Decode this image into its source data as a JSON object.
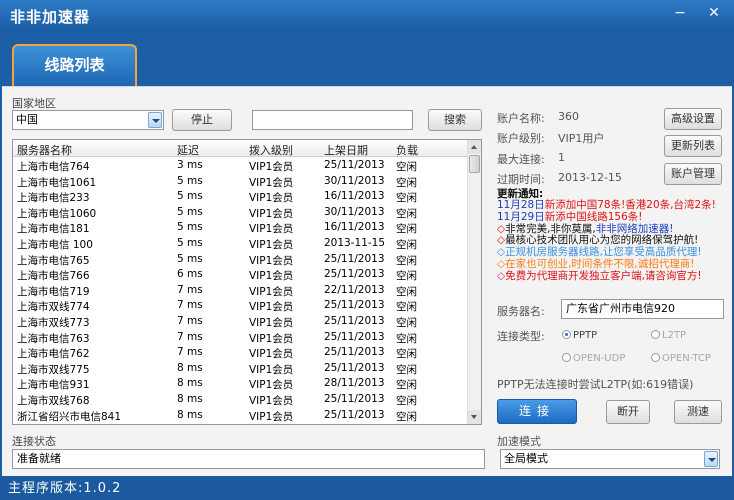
{
  "window": {
    "title": "非非加速器",
    "tab_label": "线路列表",
    "version_text": "主程序版本:1.0.2"
  },
  "region": {
    "label": "国家地区",
    "selected": "中国",
    "stop_label": "停止",
    "search_value": "",
    "search_label": "搜索"
  },
  "table": {
    "columns": [
      "服务器名称",
      "延迟",
      "拨入级别",
      "上架日期",
      "负载"
    ],
    "rows": [
      [
        "上海市电信764",
        "3 ms",
        "VIP1会员",
        "25/11/2013",
        "空闲"
      ],
      [
        "上海市电信1061",
        "5 ms",
        "VIP1会员",
        "30/11/2013",
        "空闲"
      ],
      [
        "上海市电信233",
        "5 ms",
        "VIP1会员",
        "16/11/2013",
        "空闲"
      ],
      [
        "上海市电信1060",
        "5 ms",
        "VIP1会员",
        "30/11/2013",
        "空闲"
      ],
      [
        "上海市电信181",
        "5 ms",
        "VIP1会员",
        "16/11/2013",
        "空闲"
      ],
      [
        "上海市电信 100",
        "5 ms",
        "VIP1会员",
        "2013-11-15",
        "空闲"
      ],
      [
        "上海市电信765",
        "5 ms",
        "VIP1会员",
        "25/11/2013",
        "空闲"
      ],
      [
        "上海市电信766",
        "6 ms",
        "VIP1会员",
        "25/11/2013",
        "空闲"
      ],
      [
        "上海市电信719",
        "7 ms",
        "VIP1会员",
        "22/11/2013",
        "空闲"
      ],
      [
        "上海市双线774",
        "7 ms",
        "VIP1会员",
        "25/11/2013",
        "空闲"
      ],
      [
        "上海市双线773",
        "7 ms",
        "VIP1会员",
        "25/11/2013",
        "空闲"
      ],
      [
        "上海市电信763",
        "7 ms",
        "VIP1会员",
        "25/11/2013",
        "空闲"
      ],
      [
        "上海市电信762",
        "7 ms",
        "VIP1会员",
        "25/11/2013",
        "空闲"
      ],
      [
        "上海市双线775",
        "8 ms",
        "VIP1会员",
        "25/11/2013",
        "空闲"
      ],
      [
        "上海市电信931",
        "8 ms",
        "VIP1会员",
        "28/11/2013",
        "空闲"
      ],
      [
        "上海市双线768",
        "8 ms",
        "VIP1会员",
        "25/11/2013",
        "空闲"
      ],
      [
        "浙江省绍兴市电信841",
        "8 ms",
        "VIP1会员",
        "25/11/2013",
        "空闲"
      ]
    ]
  },
  "account": {
    "name_label": "账户名称:",
    "name_value": "360",
    "level_label": "账户级别:",
    "level_value": "VIP1用户",
    "maxconn_label": "最大连接:",
    "maxconn_value": "1",
    "expire_label": "过期时间:",
    "expire_value": "2013-12-15",
    "btn_advanced": "高级设置",
    "btn_refresh": "更新列表",
    "btn_manage": "账户管理"
  },
  "notice": {
    "title": "更新通知:",
    "lines": [
      {
        "prefix": "11月28日",
        "text": "新添加中国78条!香港20条,台湾2条!"
      },
      {
        "prefix": "11月29日",
        "text": "新添中国线路156条!"
      },
      {
        "prefix": "◇",
        "text": "非常完美,非你莫属,",
        "tail": "非非网络加速器!"
      },
      {
        "prefix": "◇",
        "text": "最核心技术团队用心为您的网络保驾护航!"
      },
      {
        "prefix": "◇",
        "text": "正规机房服务器线路,让您享受高品质代理!"
      },
      {
        "prefix": "◇",
        "text": "在家也可创业,时间条件不限,诚招代理商!"
      },
      {
        "prefix": "◇",
        "text": "免费为代理商开发独立客户端,请咨询官方!"
      }
    ],
    "colors": {
      "date": "#1b3fb8",
      "red": "#e01010",
      "black": "#111111",
      "blue": "#1a3fc0",
      "lightblue": "#3a8fe0",
      "orange": "#ff7a10",
      "pink": "#e0207a"
    }
  },
  "server": {
    "label": "服务器名:",
    "value": "广东省广州市电信920"
  },
  "conn_type": {
    "label": "连接类型:",
    "options": [
      "PPTP",
      "L2TP",
      "OPEN-UDP",
      "OPEN-TCP"
    ],
    "selected": "PPTP"
  },
  "hint": "PPTP无法连接时尝试L2TP(如:619错误)",
  "actions": {
    "connect": "连接",
    "disconnect": "断开",
    "test": "测速"
  },
  "status": {
    "label": "连接状态",
    "value": "准备就绪"
  },
  "accel": {
    "label": "加速模式",
    "selected": "全局模式"
  },
  "colors": {
    "window_blue": "#1d5fa6",
    "tab_border": "#f2a33a",
    "connect_btn": "#2d7fd4"
  }
}
